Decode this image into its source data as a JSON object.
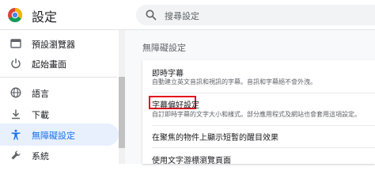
{
  "header": {
    "title": "設定",
    "search_placeholder": "搜尋設定"
  },
  "sidebar": {
    "items": [
      {
        "label": "預設瀏覽器",
        "icon": "browser-window-icon"
      },
      {
        "label": "起始畫面",
        "icon": "power-icon"
      },
      {
        "label": "語言",
        "icon": "globe-icon"
      },
      {
        "label": "下載",
        "icon": "download-icon"
      },
      {
        "label": "無障礙設定",
        "icon": "accessibility-icon",
        "active": true
      },
      {
        "label": "系統",
        "icon": "wrench-icon"
      }
    ]
  },
  "main": {
    "section_title": "無障礙設定",
    "rows": [
      {
        "title": "即時字幕",
        "description": "自動建立英文音訊和視訊的字幕。音訊和字幕絕不會外洩。"
      },
      {
        "title": "字幕偏好設定",
        "description": "自訂即時字幕的文字大小和樣式。部分應用程式及網站也會套用這項設定。",
        "highlighted": true
      },
      {
        "title": "在聚焦的物件上顯示短暫的醒目效果",
        "description": ""
      },
      {
        "title": "使用文字游標瀏覽頁面",
        "description": ""
      }
    ]
  },
  "colors": {
    "accent": "#1a73e8",
    "active_bg": "#e8f0fe",
    "highlight_border": "#e3101d"
  }
}
